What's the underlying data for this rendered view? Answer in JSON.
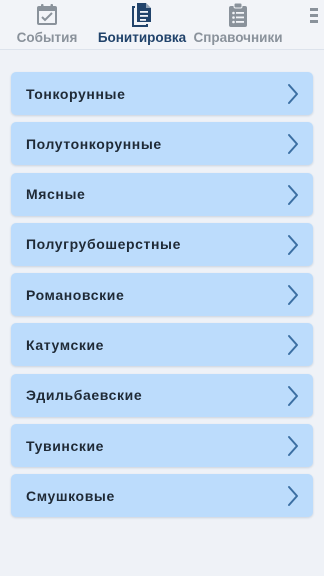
{
  "tabs": [
    {
      "label": "События",
      "icon": "calendar-check-icon",
      "active": false
    },
    {
      "label": "Бонитировка",
      "icon": "documents-icon",
      "active": true
    },
    {
      "label": "Справочники",
      "icon": "clipboard-list-icon",
      "active": false
    }
  ],
  "breeds": [
    {
      "label": "Тонкорунные"
    },
    {
      "label": "Полутонкорунные"
    },
    {
      "label": "Мясные"
    },
    {
      "label": "Полугрубошерстные"
    },
    {
      "label": "Романовские"
    },
    {
      "label": "Катумские"
    },
    {
      "label": "Эдильбаевские"
    },
    {
      "label": "Тувинские"
    },
    {
      "label": "Смушковые"
    }
  ],
  "colors": {
    "active_tab": "#21436b",
    "inactive_tab": "#8a929b",
    "item_bg": "#bcdcfc",
    "chevron": "#3b6fa3",
    "background": "#eff2f7"
  }
}
